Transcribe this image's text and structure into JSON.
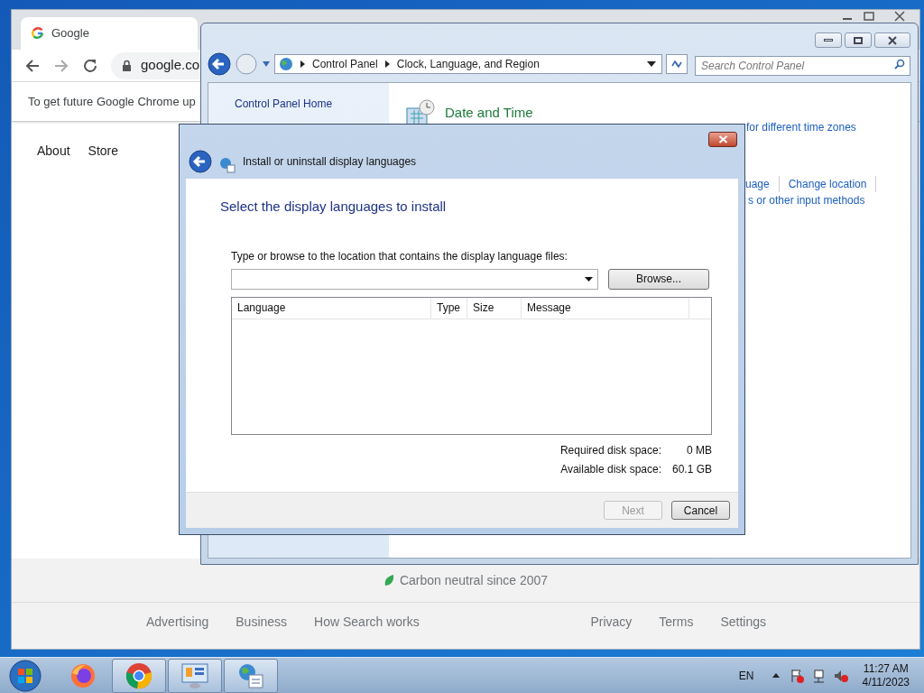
{
  "chrome": {
    "tab_title": "Google",
    "url": "google.co",
    "infobar": "To get future Google Chrome up",
    "nav_links": [
      "About",
      "Store"
    ],
    "footer_note": "Carbon neutral since 2007",
    "footer_left": [
      "Advertising",
      "Business",
      "How Search works"
    ],
    "footer_right": [
      "Privacy",
      "Terms",
      "Settings"
    ]
  },
  "control_panel": {
    "breadcrumb": [
      "Control Panel",
      "Clock, Language, and Region"
    ],
    "search": {
      "placeholder": "Search Control Panel"
    },
    "sidebar": [
      "Control Panel Home"
    ],
    "section_title": "Date and Time",
    "section_link": "for different time zones",
    "region_links": [
      "uage",
      "Change location"
    ],
    "region_link_2": "s or other input methods"
  },
  "dialog": {
    "title": "Install or uninstall display languages",
    "heading": "Select the display languages to install",
    "prompt": "Type or browse to the location that contains the display language files:",
    "browse": "Browse...",
    "columns": [
      "Language",
      "Type",
      "Size",
      "Message"
    ],
    "disk": [
      {
        "label": "Required disk space:",
        "value": "0 MB"
      },
      {
        "label": "Available disk space:",
        "value": "60.1 GB"
      }
    ],
    "buttons": [
      {
        "label": "Next",
        "disabled": true
      },
      {
        "label": "Cancel",
        "disabled": false
      }
    ]
  },
  "taskbar": {
    "apps": [
      {
        "kind": "firefox",
        "open": false
      },
      {
        "kind": "chrome",
        "open": true
      },
      {
        "kind": "control-panel",
        "open": true
      },
      {
        "kind": "language",
        "open": true
      }
    ],
    "language": "EN",
    "time": "11:27 AM",
    "date": "4/11/2023"
  }
}
